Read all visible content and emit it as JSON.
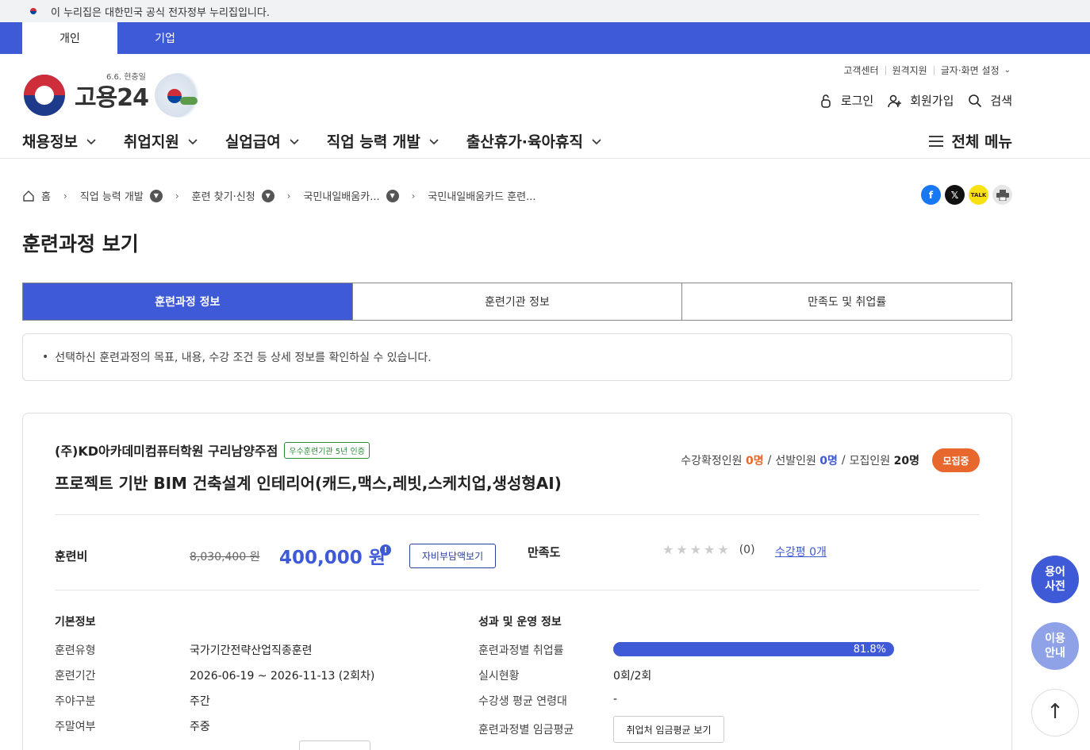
{
  "gov_banner": {
    "text": "이 누리집은 대한민국 공식 전자정부 누리집입니다."
  },
  "user_tabs": [
    {
      "label": "개인"
    },
    {
      "label": "기업"
    }
  ],
  "logo": {
    "sub": "6.6. 현충일",
    "text": "고용24"
  },
  "util_links": [
    "고객센터",
    "원격지원",
    "글자·화면 설정"
  ],
  "auth": {
    "login": "로그인",
    "signup": "회원가입",
    "search": "검색"
  },
  "gnb": [
    "채용정보",
    "취업지원",
    "실업급여",
    "직업 능력 개발",
    "출산휴가·육아휴직"
  ],
  "all_menu": "전체 메뉴",
  "breadcrumb": [
    "홈",
    "직업 능력 개발",
    "훈련 찾기·신청",
    "국민내일배움카...",
    "국민내일배움카드 훈련..."
  ],
  "page_title": "훈련과정 보기",
  "tabs": [
    "훈련과정 정보",
    "훈련기관 정보",
    "만족도 및 취업률"
  ],
  "notice": "선택하신 훈련과정의 목표, 내용, 수강 조건 등 상세 정보를 확인하실 수 있습니다.",
  "course": {
    "institution": "(주)KD아카데미컴퓨터학원 구리남양주점",
    "badge": "우수훈련기관 5년 인증",
    "title": "프로젝트 기반 BIM 건축설계 인테리어(캐드,맥스,레빗,스케치업,생성형AI)",
    "enroll": {
      "confirmed_label": "수강확정인원",
      "confirmed": "0명",
      "selected_label": "선발인원",
      "selected": "0명",
      "recruit_label": "모집인원",
      "recruit": "20명",
      "status": "모집중"
    },
    "fee": {
      "label": "훈련비",
      "original": "8,030,400 원",
      "current": "400,000 원",
      "info_icon": "!",
      "self_pay_button": "자비부담액보기"
    },
    "satisfaction": {
      "label": "만족도",
      "stars": "★★★★★",
      "rating": 0,
      "count": "(0)",
      "review_link": "수강평 0개"
    },
    "basic_info": {
      "title": "기본정보",
      "rows": [
        {
          "label": "훈련유형",
          "value": "국가기간전략산업직종훈련"
        },
        {
          "label": "훈련기간",
          "value": "2026-06-19 ~ 2026-11-13 (2회차)"
        },
        {
          "label": "주야구분",
          "value": "주간"
        },
        {
          "label": "주말여부",
          "value": "주중"
        }
      ]
    },
    "performance": {
      "title": "성과 및 운영 정보",
      "rows": [
        {
          "label": "훈련과정별 취업률",
          "value": "81.8%"
        },
        {
          "label": "실시현황",
          "value": "0회/2회"
        },
        {
          "label": "수강생 평균 연령대",
          "value": "-"
        },
        {
          "label": "훈련과정별 임금평균",
          "value": "취업처 임금평균 보기"
        }
      ],
      "employment_rate_pct": 100
    }
  },
  "floating": {
    "dict": "용어\n사전",
    "guide": "이용\n안내",
    "top": "↑"
  }
}
